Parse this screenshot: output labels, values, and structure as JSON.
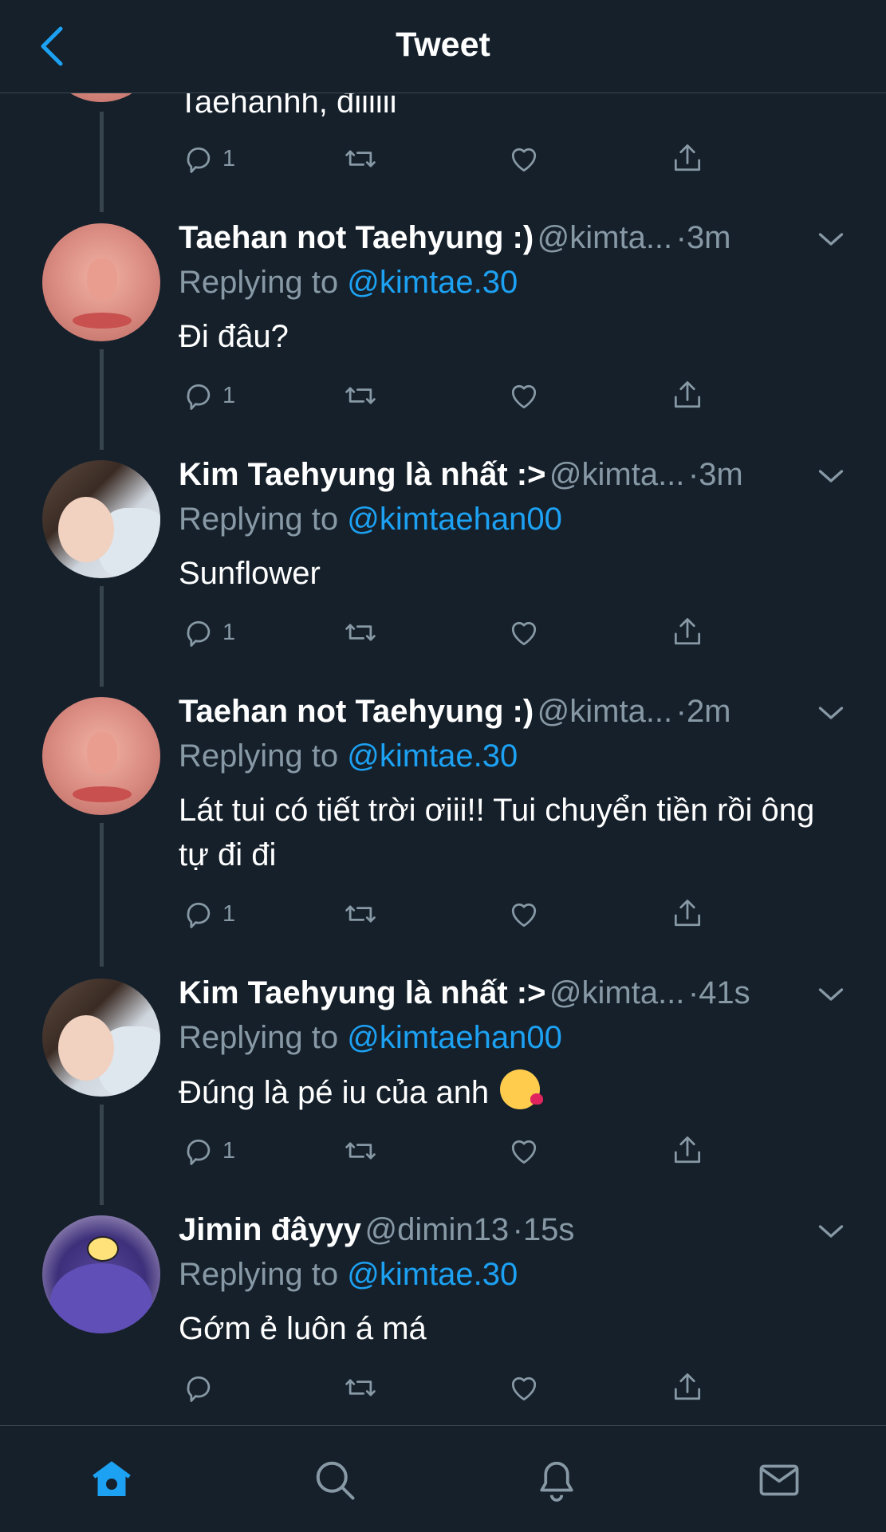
{
  "header": {
    "title": "Tweet"
  },
  "partial_tweet": {
    "text": "Taehanhh, điiiiii",
    "reply_count": "1"
  },
  "replies": [
    {
      "name": "Taehan not Taehyung :)",
      "handle": "@kimta...",
      "time": "3m",
      "replying_prefix": "Replying to",
      "replying_to": "@kimtae.30",
      "text": "Đi đâu?",
      "reply_count": "1"
    },
    {
      "name": "Kim Taehyung là nhất :>",
      "handle": "@kimta...",
      "time": "3m",
      "replying_prefix": "Replying to",
      "replying_to": "@kimtaehan00",
      "text": "Sunflower",
      "reply_count": "1"
    },
    {
      "name": "Taehan not Taehyung :)",
      "handle": "@kimta...",
      "time": "2m",
      "replying_prefix": "Replying to",
      "replying_to": "@kimtae.30",
      "text": "Lát tui có tiết trời ơiii!! Tui chuyển tiền rồi ông tự đi đi",
      "reply_count": "1"
    },
    {
      "name": "Kim Taehyung là nhất :>",
      "handle": "@kimta...",
      "time": "41s",
      "replying_prefix": "Replying to",
      "replying_to": "@kimtaehan00",
      "text": "Đúng là pé iu của anh",
      "emoji": "face-blowing-kiss",
      "reply_count": "1"
    },
    {
      "name": "Jimin đâyyy",
      "handle": "@dimin13",
      "time": "15s",
      "replying_prefix": "Replying to",
      "replying_to": "@kimtae.30",
      "text": "Gớm ẻ luôn á má",
      "reply_count": ""
    }
  ],
  "dot": "·",
  "icons": {
    "back": "chevron-left-icon",
    "reply": "reply-icon",
    "retweet": "retweet-icon",
    "like": "heart-icon",
    "share": "share-icon",
    "more": "chevron-down-icon",
    "home": "home-icon",
    "search": "search-icon",
    "notifications": "bell-icon",
    "messages": "mail-icon"
  },
  "colors": {
    "background": "#15202b",
    "accent": "#1da1f2",
    "secondary_text": "#8899a6",
    "divider": "#38444d"
  }
}
